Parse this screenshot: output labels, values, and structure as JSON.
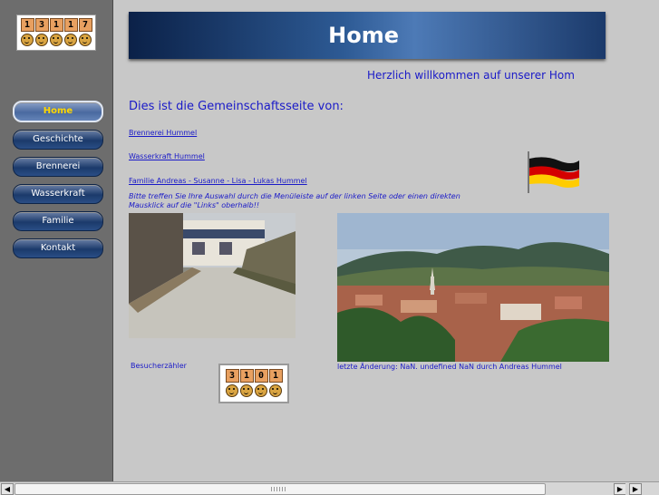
{
  "counter_top": [
    "1",
    "3",
    "1",
    "1",
    "7"
  ],
  "nav": [
    "Home",
    "Geschichte",
    "Brennerei",
    "Wasserkraft",
    "Familie",
    "Kontakt"
  ],
  "banner_title": "Home",
  "welcome": "Herzlich willkommen auf unserer Hom",
  "intro": "Dies ist die Gemeinschaftsseite von:",
  "links": {
    "brennerei": "Brennerei Hummel",
    "wasserkraft": "Wasserkraft Hummel",
    "familie": "Familie Andreas - Susanne - Lisa - Lukas Hummel"
  },
  "hint": "Bitte treffen Sie Ihre Auswahl durch die Menüleiste auf der linken Seite oder einen direkten Mausklick auf die \"Links\" oberhalb!!",
  "visitor_label": "Besucherzähler",
  "counter_bottom": [
    "3",
    "1",
    "0",
    "1"
  ],
  "last_changed": "letzte Änderung: NaN. undefined NaN durch Andreas Hummel",
  "colors": {
    "link": "#1a1ac8",
    "sidebar": "#6d6d6d",
    "banner": "#1b3a6b"
  }
}
